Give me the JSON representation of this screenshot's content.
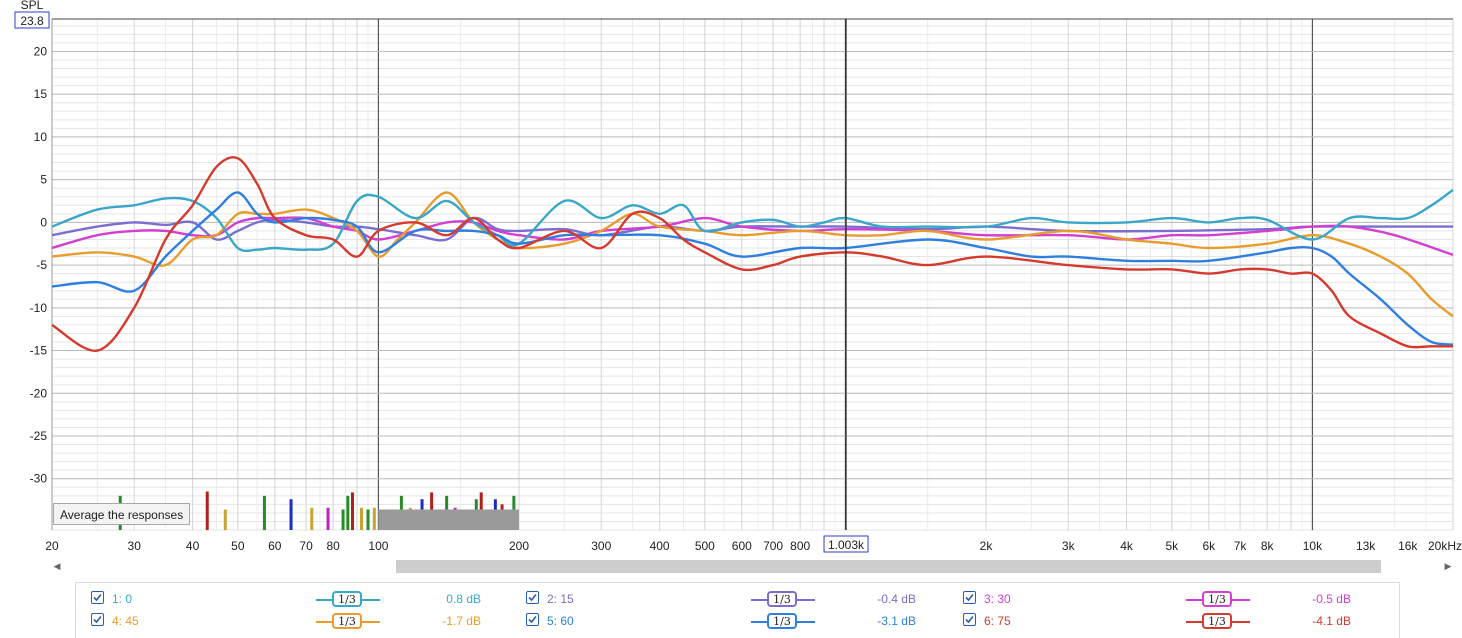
{
  "chart_data": {
    "type": "line",
    "x_scale": "log",
    "xlim": [
      20,
      20000
    ],
    "ylim": [
      -36,
      23.8
    ],
    "ylabel": "SPL",
    "y_top_readout": "23.8",
    "cursor_readout": "1.003k",
    "cursor_x": 1003,
    "y_ticks": [
      20,
      15,
      10,
      5,
      0,
      -5,
      -10,
      -15,
      -20,
      -25,
      -30
    ],
    "x_ticks": [
      {
        "v": 20,
        "label": "20"
      },
      {
        "v": 30,
        "label": "30"
      },
      {
        "v": 40,
        "label": "40"
      },
      {
        "v": 50,
        "label": "50"
      },
      {
        "v": 60,
        "label": "60"
      },
      {
        "v": 70,
        "label": "70"
      },
      {
        "v": 80,
        "label": "80"
      },
      {
        "v": 100,
        "label": "100"
      },
      {
        "v": 200,
        "label": "200"
      },
      {
        "v": 300,
        "label": "300"
      },
      {
        "v": 400,
        "label": "400"
      },
      {
        "v": 500,
        "label": "500"
      },
      {
        "v": 600,
        "label": "600"
      },
      {
        "v": 700,
        "label": "700"
      },
      {
        "v": 800,
        "label": "800"
      },
      {
        "v": 2000,
        "label": "2k"
      },
      {
        "v": 3000,
        "label": "3k"
      },
      {
        "v": 4000,
        "label": "4k"
      },
      {
        "v": 5000,
        "label": "5k"
      },
      {
        "v": 6000,
        "label": "6k"
      },
      {
        "v": 7000,
        "label": "7k"
      },
      {
        "v": 8000,
        "label": "8k"
      },
      {
        "v": 10000,
        "label": "10k"
      },
      {
        "v": 13000,
        "label": "13k",
        "muted": true
      },
      {
        "v": 16000,
        "label": "16k",
        "muted": true
      },
      {
        "v": 20000,
        "label": "20kHz"
      }
    ],
    "grid": true,
    "series": [
      {
        "name": "1: 0",
        "color": "#3aa7c9",
        "x": [
          20,
          25,
          30,
          35,
          40,
          45,
          50,
          55,
          60,
          70,
          80,
          90,
          100,
          120,
          140,
          160,
          180,
          200,
          250,
          300,
          350,
          400,
          450,
          500,
          600,
          700,
          800,
          900,
          1000,
          1200,
          1500,
          2000,
          2500,
          3000,
          4000,
          5000,
          6000,
          7000,
          8000,
          10000,
          12000,
          14000,
          16000,
          18000,
          20000
        ],
        "y": [
          -0.5,
          1.5,
          2,
          2.8,
          2.5,
          0.5,
          -3,
          -3.2,
          -3,
          -3.2,
          -2.5,
          2.5,
          3,
          0.5,
          2.5,
          0,
          -1.5,
          -2.5,
          2.5,
          0.5,
          2,
          1,
          2,
          -1,
          0,
          0.3,
          -0.5,
          0,
          0.5,
          -0.5,
          -0.5,
          -0.5,
          0.5,
          0,
          0,
          0.5,
          0,
          0.5,
          0.3,
          -2,
          0.5,
          0.5,
          0.5,
          2,
          3.8
        ]
      },
      {
        "name": "2: 15",
        "color": "#7a6fd0",
        "x": [
          20,
          25,
          30,
          35,
          40,
          45,
          50,
          55,
          60,
          70,
          80,
          90,
          100,
          120,
          140,
          160,
          180,
          200,
          250,
          300,
          400,
          500,
          600,
          800,
          1000,
          1500,
          2000,
          3000,
          5000,
          8000,
          10000,
          15000,
          20000
        ],
        "y": [
          -1.5,
          -0.5,
          0,
          -0.3,
          0,
          -2,
          -1,
          0,
          0.3,
          0,
          -0.5,
          -0.5,
          -0.8,
          -1.5,
          -2,
          0.5,
          -0.8,
          -1,
          -0.8,
          -1.5,
          -0.5,
          -1,
          -0.5,
          -0.5,
          -0.5,
          -0.8,
          -0.5,
          -1,
          -1,
          -0.8,
          -0.5,
          -0.5,
          -0.5
        ]
      },
      {
        "name": "3: 30",
        "color": "#d23fd2",
        "x": [
          20,
          25,
          30,
          35,
          40,
          45,
          50,
          55,
          60,
          70,
          80,
          90,
          100,
          120,
          140,
          160,
          180,
          200,
          250,
          300,
          400,
          500,
          600,
          800,
          1000,
          1500,
          2000,
          3000,
          4000,
          5000,
          6000,
          8000,
          10000,
          12000,
          15000,
          20000
        ],
        "y": [
          -3,
          -1.5,
          -1,
          -1,
          -1.5,
          -1.5,
          0,
          0.5,
          0.5,
          0.5,
          -0.5,
          -1,
          -2,
          -1,
          0,
          0,
          -1,
          -1.5,
          -2,
          -1,
          -0.5,
          0.5,
          -0.5,
          -1,
          -0.8,
          -1,
          -1.5,
          -1.5,
          -2,
          -1.5,
          -1.5,
          -1,
          -0.5,
          -0.5,
          -1.5,
          -3.8
        ]
      },
      {
        "name": "4: 45",
        "color": "#e89c2e",
        "x": [
          20,
          25,
          30,
          35,
          40,
          45,
          50,
          55,
          60,
          70,
          80,
          90,
          100,
          110,
          120,
          140,
          160,
          180,
          200,
          250,
          300,
          350,
          400,
          500,
          600,
          800,
          1000,
          1200,
          1500,
          2000,
          3000,
          4000,
          5000,
          6000,
          8000,
          10000,
          12000,
          14000,
          16000,
          18000,
          20000
        ],
        "y": [
          -4,
          -3.5,
          -4,
          -5,
          -2,
          -1.5,
          1,
          1,
          1,
          1.5,
          0.5,
          -1,
          -4,
          -2,
          0,
          3.5,
          0,
          -2,
          -3,
          -2.5,
          -1,
          1,
          -0.5,
          -1,
          -1.5,
          -1,
          -1.5,
          -1.5,
          -1,
          -2,
          -1,
          -2,
          -2.5,
          -3,
          -2.5,
          -1.5,
          -2.5,
          -4,
          -6,
          -9,
          -11
        ]
      },
      {
        "name": "5: 60",
        "color": "#2f7fe0",
        "x": [
          20,
          25,
          30,
          35,
          40,
          45,
          50,
          55,
          60,
          70,
          80,
          90,
          100,
          120,
          140,
          160,
          180,
          200,
          250,
          300,
          400,
          500,
          600,
          800,
          1000,
          1500,
          2000,
          2500,
          3000,
          4000,
          5000,
          6000,
          8000,
          9000,
          10000,
          11000,
          12000,
          14000,
          16000,
          18000,
          20000
        ],
        "y": [
          -7.5,
          -7,
          -8,
          -4,
          -1,
          1.5,
          3.5,
          1,
          0,
          0.5,
          0.3,
          -0.5,
          -3.5,
          -1,
          -1,
          -1,
          -1.5,
          -2.5,
          -1.5,
          -1.5,
          -1.5,
          -2.5,
          -4,
          -3,
          -3,
          -2,
          -3,
          -4,
          -4,
          -4.5,
          -4.5,
          -4.5,
          -3.5,
          -3,
          -3,
          -4,
          -6,
          -9,
          -12,
          -14,
          -14.3
        ]
      },
      {
        "name": "6: 75",
        "color": "#d43a2e",
        "x": [
          20,
          25,
          30,
          35,
          40,
          45,
          50,
          55,
          60,
          70,
          80,
          90,
          100,
          120,
          140,
          160,
          180,
          200,
          250,
          300,
          350,
          400,
          450,
          500,
          600,
          700,
          800,
          1000,
          1200,
          1500,
          2000,
          3000,
          4000,
          5000,
          6000,
          7000,
          8000,
          9000,
          10000,
          11000,
          12000,
          14000,
          16000,
          18000,
          20000
        ],
        "y": [
          -12,
          -15,
          -10,
          -2,
          2,
          6.5,
          7.5,
          4.5,
          0.5,
          -1.5,
          -2,
          -4,
          -1,
          0,
          -1.5,
          0.5,
          -2,
          -3,
          -1,
          -3,
          1,
          0.5,
          -2,
          -3.5,
          -5.5,
          -5,
          -4,
          -3.5,
          -4,
          -5,
          -4,
          -5,
          -5.5,
          -5.5,
          -6,
          -5.5,
          -5.5,
          -6,
          -6,
          -8,
          -11,
          -13,
          -14.5,
          -14.5,
          -14.5
        ]
      }
    ],
    "bars": [
      {
        "f": 28,
        "h": 4.0,
        "c": "#2a8a2a"
      },
      {
        "f": 43,
        "h": 4.5,
        "c": "#b0201c"
      },
      {
        "f": 47,
        "h": 2.4,
        "c": "#c8a233"
      },
      {
        "f": 57,
        "h": 4.0,
        "c": "#2a8a2a"
      },
      {
        "f": 65,
        "h": 3.6,
        "c": "#1a2fc0"
      },
      {
        "f": 72,
        "h": 2.6,
        "c": "#c8a233"
      },
      {
        "f": 78,
        "h": 2.6,
        "c": "#c020c0"
      },
      {
        "f": 84,
        "h": 2.4,
        "c": "#2a8a2a"
      },
      {
        "f": 86,
        "h": 4.0,
        "c": "#2a8a2a"
      },
      {
        "f": 88,
        "h": 4.4,
        "c": "#b0201c"
      },
      {
        "f": 92,
        "h": 2.6,
        "c": "#c8a233"
      },
      {
        "f": 95,
        "h": 2.4,
        "c": "#2a8a2a"
      },
      {
        "f": 98,
        "h": 2.6,
        "c": "#c8a233"
      },
      {
        "f": 112,
        "h": 4.0,
        "c": "#2a8a2a"
      },
      {
        "f": 117,
        "h": 2.6,
        "c": "#c8a233"
      },
      {
        "f": 124,
        "h": 3.6,
        "c": "#1a2fc0"
      },
      {
        "f": 130,
        "h": 4.4,
        "c": "#b0201c"
      },
      {
        "f": 140,
        "h": 4.0,
        "c": "#2a8a2a"
      },
      {
        "f": 146,
        "h": 2.6,
        "c": "#c020c0"
      },
      {
        "f": 162,
        "h": 3.6,
        "c": "#2a8a2a"
      },
      {
        "f": 166,
        "h": 4.4,
        "c": "#b0201c"
      },
      {
        "f": 178,
        "h": 3.6,
        "c": "#1a2fc0"
      },
      {
        "f": 184,
        "h": 3.0,
        "c": "#b0201c"
      },
      {
        "f": 195,
        "h": 4.0,
        "c": "#2a8a2a"
      }
    ]
  },
  "ui": {
    "average_button": "Average the responses"
  },
  "legend": [
    {
      "check": "☑",
      "label": "1: 0",
      "color": "#3aa7c9",
      "smoothing": "1/3",
      "avg": "0.8 dB"
    },
    {
      "check": "☑",
      "label": "2: 15",
      "color": "#7a6fd0",
      "smoothing": "1/3",
      "avg": "-0.4 dB"
    },
    {
      "check": "☑",
      "label": "3: 30",
      "color": "#d23fd2",
      "smoothing": "1/3",
      "avg": "-0.5 dB"
    },
    {
      "check": "☑",
      "label": "4: 45",
      "color": "#e89c2e",
      "smoothing": "1/3",
      "avg": "-1.7 dB"
    },
    {
      "check": "☑",
      "label": "5: 60",
      "color": "#2f7fe0",
      "smoothing": "1/3",
      "avg": "-3.1 dB"
    },
    {
      "check": "☑",
      "label": "6: 75",
      "color": "#d43a2e",
      "smoothing": "1/3",
      "avg": "-4.1 dB"
    }
  ]
}
